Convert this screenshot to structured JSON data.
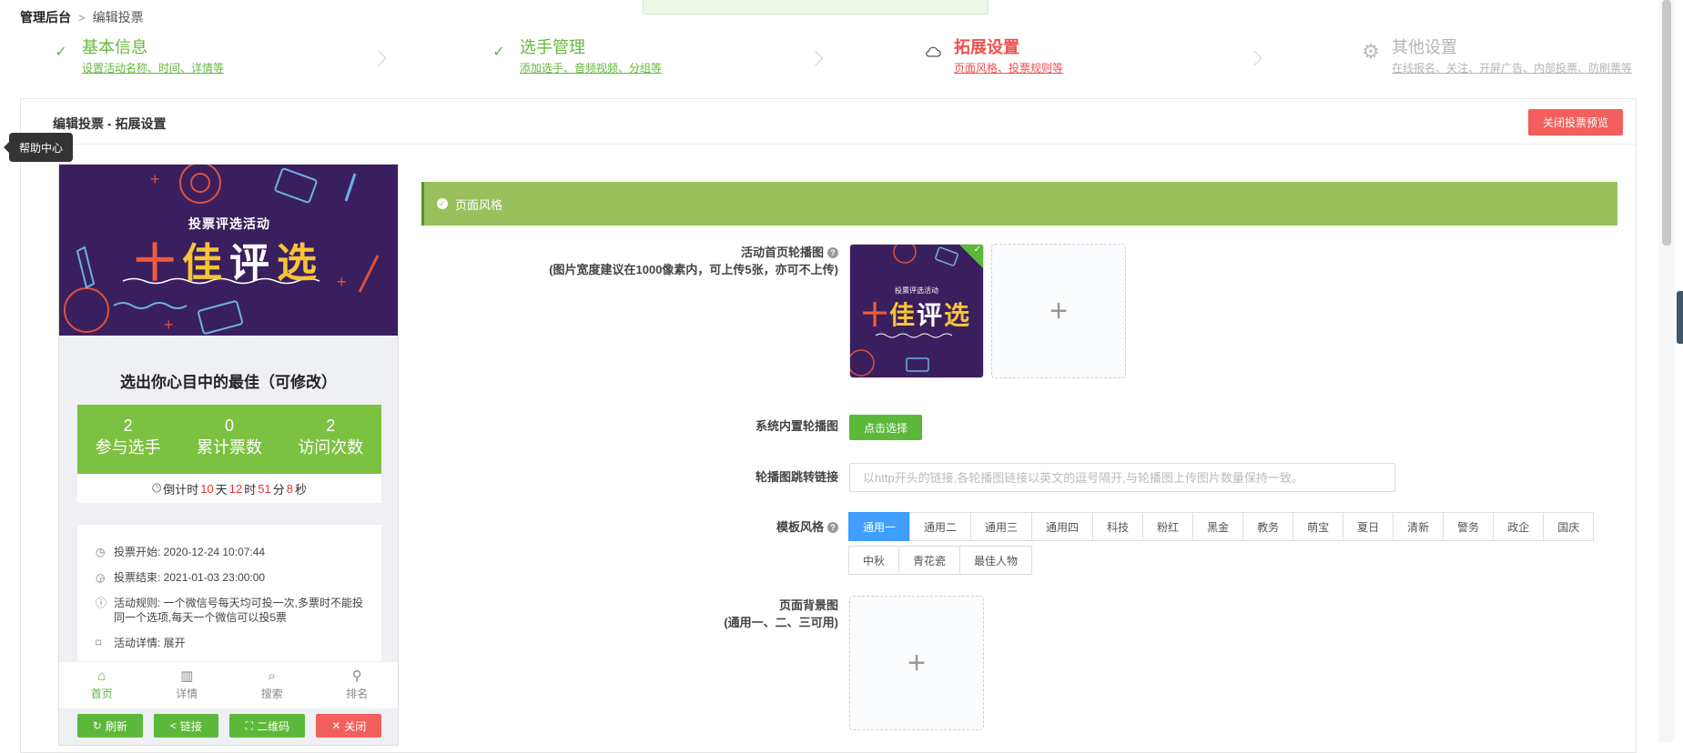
{
  "breadcrumb": {
    "root": "管理后台",
    "sep": ">",
    "current": "编辑投票"
  },
  "steps": [
    {
      "title": "基本信息",
      "sub": "设置活动名称、时间、详情等",
      "state": "done"
    },
    {
      "title": "选手管理",
      "sub": "添加选手、音频视频、分组等",
      "state": "done"
    },
    {
      "title": "拓展设置",
      "sub": "页面风格、投票规则等",
      "state": "current"
    },
    {
      "title": "其他设置",
      "sub": "在线报名、关注、开屏广告、内部投票、防刷票等",
      "state": "pending"
    }
  ],
  "panel": {
    "title": "编辑投票 - 拓展设置",
    "close_preview": "关闭投票预览"
  },
  "help_tip": "帮助中心",
  "preview": {
    "banner_sub": "投票评选活动",
    "banner_big": [
      "十",
      "佳",
      "评",
      "选"
    ],
    "title": "选出你心目中的最佳（可修改）",
    "stats": [
      {
        "value": "2",
        "label": "参与选手"
      },
      {
        "value": "0",
        "label": "累计票数"
      },
      {
        "value": "2",
        "label": "访问次数"
      }
    ],
    "countdown": {
      "prefix": "倒计时",
      "days": "10",
      "d": "天",
      "hours": "12",
      "h": "时",
      "mins": "51",
      "m": "分",
      "secs": "8",
      "s": "秒"
    },
    "info": {
      "start": "投票开始: 2020-12-24 10:07:44",
      "end": "投票结束: 2021-01-03 23:00:00",
      "rule": "活动规则: 一个微信号每天均可投一次,多票时不能投同一个选项,每天一个微信可以投5票",
      "detail": "活动详情: 展开"
    },
    "tabs": [
      "首页",
      "详情",
      "搜索",
      "排名"
    ],
    "buttons": {
      "refresh": "刷新",
      "link": "链接",
      "qrcode": "二维码",
      "close": "关闭"
    }
  },
  "settings": {
    "section_title": "页面风格",
    "carousel_label": "活动首页轮播图",
    "carousel_hint": "(图片宽度建议在1000像素内，可上传5张，亦可不上传)",
    "builtin_label": "系统内置轮播图",
    "builtin_button": "点击选择",
    "link_label": "轮播图跳转链接",
    "link_placeholder": "以http开头的链接,各轮播图链接以英文的逗号隔开,与轮播图上传图片数量保持一致。",
    "template_label": "模板风格",
    "templates_row1": [
      "通用一",
      "通用二",
      "通用三",
      "通用四",
      "科技",
      "粉红",
      "黑金",
      "教务",
      "萌宝",
      "夏日",
      "清新",
      "警务",
      "政企",
      "国庆"
    ],
    "templates_row2": [
      "中秋",
      "青花瓷",
      "最佳人物"
    ],
    "template_selected": "通用一",
    "bg_label": "页面背景图",
    "bg_hint": "(通用一、二、三可用)",
    "plus": "+"
  },
  "colors": {
    "green": "#5cb83a",
    "red": "#f25f5c",
    "blue": "#409eff",
    "section": "#98c05c"
  }
}
